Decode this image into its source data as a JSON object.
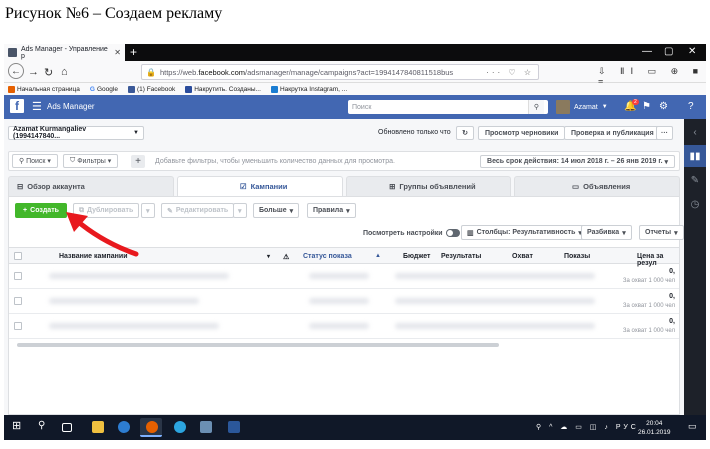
{
  "caption": "Рисунок №6 – Создаем рекламу",
  "browser": {
    "tab_title": "Ads Manager - Управление р",
    "url_prefix": "https://web.",
    "url_host": "facebook.com",
    "url_rest": "/adsmanager/manage/campaigns?act=1994147840811518bus",
    "bookmarks": [
      "Начальная страница",
      "Google",
      "(1) Facebook",
      "Накрутить. Созданы...",
      "Накрутка Instagram, ..."
    ]
  },
  "fb": {
    "app_name": "Ads Manager",
    "search_placeholder": "Поиск",
    "user_name": "Azamat",
    "notif_count": "2"
  },
  "account": {
    "name": "Azamat Kurmangaliev (1994147840..."
  },
  "header": {
    "view_only": "Обновлено только что",
    "drafts": "Просмотр черновики",
    "review": "Проверка и публикация",
    "more": "···"
  },
  "filters": {
    "search": "Поиск",
    "filters": "Фильтры",
    "hint": "Добавьте фильтры, чтобы уменьшить количество данных для просмотра.",
    "date_range": "Весь срок действия: 14 июл 2018 г. – 26 янв 2019 г."
  },
  "tabs": [
    "Обзор аккаунта",
    "Кампании",
    "Группы объявлений",
    "Объявления"
  ],
  "toolbar": {
    "create": "Создать",
    "duplicate": "Дублировать",
    "edit": "Редактировать",
    "more": "Больше",
    "rules": "Правила",
    "view_settings": "Посмотреть настройки",
    "columns": "Столбцы: Результативность",
    "breakdown": "Разбивка",
    "reports": "Отчеты"
  },
  "table": {
    "columns": [
      "Название кампании",
      "Статус показа",
      "Бюджет",
      "Результаты",
      "Охват",
      "Показы",
      "Цена за резул"
    ],
    "rows": [
      {
        "result": "0,",
        "sub": "За охват 1 000 чел"
      },
      {
        "result": "0,",
        "sub": "За охват 1 000 чел"
      },
      {
        "result": "0,",
        "sub": "За охват 1 000 чел"
      }
    ]
  },
  "taskbar": {
    "lang": "РУС",
    "time": "20:04",
    "date": "26.01.2019"
  }
}
